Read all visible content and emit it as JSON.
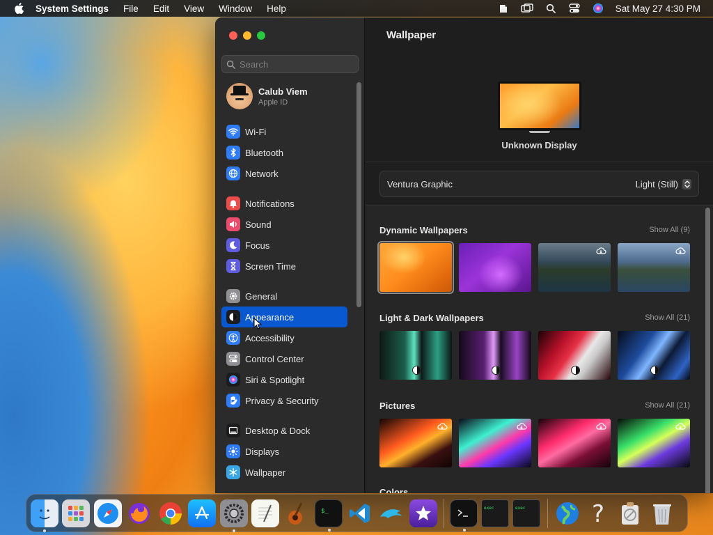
{
  "menubar": {
    "app_name": "System Settings",
    "menus": [
      "File",
      "Edit",
      "View",
      "Window",
      "Help"
    ],
    "clock": "Sat May 27  4:30 PM"
  },
  "sidebar": {
    "search_placeholder": "Search",
    "profile": {
      "name": "Calub Viem",
      "subtitle": "Apple ID"
    },
    "items": [
      {
        "label": "Wi-Fi",
        "icon": "wifi-icon",
        "color": "#2f7cf6"
      },
      {
        "label": "Bluetooth",
        "icon": "bluetooth-icon",
        "color": "#2f7cf6"
      },
      {
        "label": "Network",
        "icon": "globe-icon",
        "color": "#2f7cf6"
      },
      {
        "label": "Notifications",
        "icon": "bell-icon",
        "color": "#ec4b4b"
      },
      {
        "label": "Sound",
        "icon": "speaker-icon",
        "color": "#ec4b6e"
      },
      {
        "label": "Focus",
        "icon": "moon-icon",
        "color": "#5f5ce0"
      },
      {
        "label": "Screen Time",
        "icon": "hourglass-icon",
        "color": "#5f5ce0"
      },
      {
        "label": "General",
        "icon": "gear-icon",
        "color": "#8e8e93"
      },
      {
        "label": "Appearance",
        "icon": "appearance-icon",
        "color": "#1c1c1e",
        "active": true
      },
      {
        "label": "Accessibility",
        "icon": "accessibility-icon",
        "color": "#2f7cf6"
      },
      {
        "label": "Control Center",
        "icon": "toggles-icon",
        "color": "#8e8e93"
      },
      {
        "label": "Siri & Spotlight",
        "icon": "siri-icon",
        "color": "#7a4de0"
      },
      {
        "label": "Privacy & Security",
        "icon": "hand-icon",
        "color": "#2f7cf6"
      },
      {
        "label": "Desktop & Dock",
        "icon": "dock-icon",
        "color": "#1c1c1e"
      },
      {
        "label": "Displays",
        "icon": "sun-icon",
        "color": "#2f7cf6"
      },
      {
        "label": "Wallpaper",
        "icon": "snowflake-icon",
        "color": "#3aa6e6"
      }
    ]
  },
  "content": {
    "title": "Wallpaper",
    "display_name": "Unknown Display",
    "current_wallpaper": "Ventura Graphic",
    "appearance_mode": "Light (Still)",
    "sections": [
      {
        "title": "Dynamic Wallpapers",
        "show_all": "Show All (9)"
      },
      {
        "title": "Light & Dark Wallpapers",
        "show_all": "Show All (21)"
      },
      {
        "title": "Pictures",
        "show_all": "Show All (21)"
      }
    ],
    "colors_title": "Colors"
  },
  "dock": {
    "apps": [
      "Finder",
      "Launchpad",
      "Safari",
      "Firefox",
      "Chrome",
      "App Store",
      "System Settings",
      "TextEdit",
      "GarageBand",
      "Terminal",
      "VS Code",
      "Dolphin",
      "iMovie",
      "Terminal",
      "Terminal",
      "Terminal",
      "Globe",
      "Help",
      "Utility",
      "Trash"
    ]
  }
}
